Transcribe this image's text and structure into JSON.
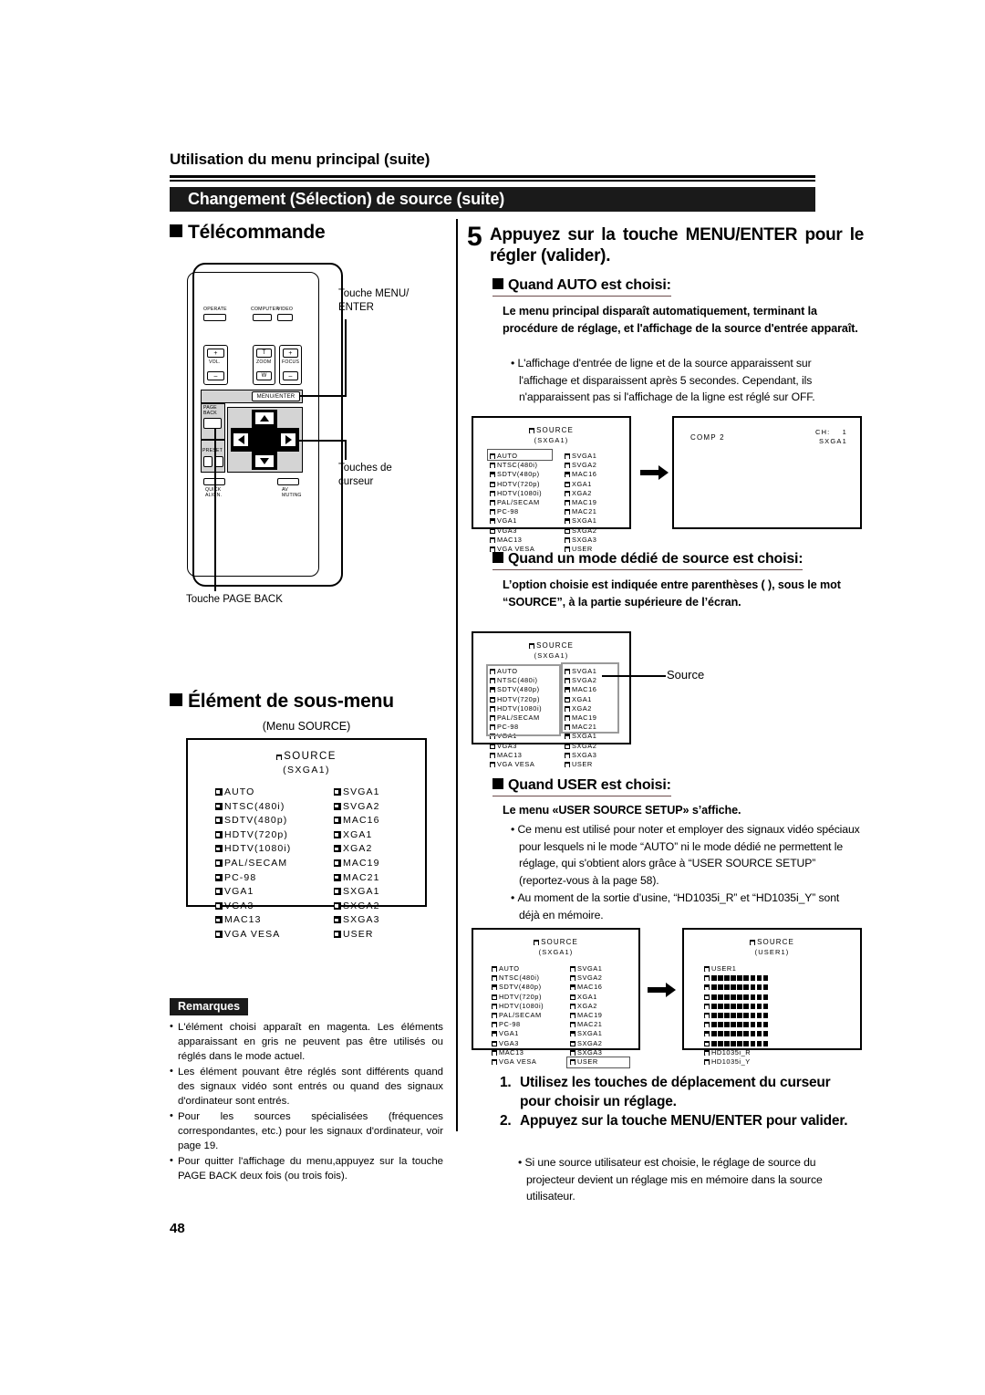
{
  "header": {
    "running_head": "Utilisation du menu principal (suite)",
    "title_band": "Changement (Sélection) de source (suite)"
  },
  "left_column": {
    "remote_heading": "Télécommande",
    "remote": {
      "buttons": [
        {
          "name": "operate",
          "label": "OPERATE"
        },
        {
          "name": "computer",
          "label": "COMPUTER"
        },
        {
          "name": "video",
          "label": "VIDEO"
        },
        {
          "name": "vol",
          "label": "VOL."
        },
        {
          "name": "vol-plus",
          "label": "+"
        },
        {
          "name": "vol-minus",
          "label": "–"
        },
        {
          "name": "zoom",
          "label": "ZOOM"
        },
        {
          "name": "zoom-t",
          "label": "T"
        },
        {
          "name": "zoom-w",
          "label": "W"
        },
        {
          "name": "focus",
          "label": "FOCUS"
        },
        {
          "name": "focus-plus",
          "label": "+"
        },
        {
          "name": "focus-minus",
          "label": "–"
        },
        {
          "name": "menu-enter",
          "label": "MENU/ENTER"
        },
        {
          "name": "page-back",
          "label": "PAGE\nBACK"
        },
        {
          "name": "preset",
          "label": "PRESET"
        },
        {
          "name": "quick-align",
          "label": "QUICK\nALIGN."
        },
        {
          "name": "av-muting",
          "label": "AV\nMUTING"
        }
      ],
      "callouts": {
        "menu_enter": "Touche MENU/\nENTER",
        "cursor": "Touches de\ncurseur",
        "page_back": "Touche PAGE BACK"
      }
    },
    "submenu_heading": "Élément de sous-menu",
    "submenu_caption": "(Menu SOURCE)",
    "remarques_label": "Remarques",
    "remarques": [
      "L'élément choisi apparaît en magenta. Les éléments apparaissant en gris ne peuvent pas être utilisés ou réglés dans le mode actuel.",
      "Les élément pouvant être réglés sont différents quand des signaux vidéo sont entrés ou quand des signaux d'ordinateur sont entrés.",
      "Pour les sources spécialisées (fréquences correspondantes, etc.) pour les signaux d'ordinateur, voir page 19.",
      "Pour quitter l'affichage du menu,appuyez sur la touche PAGE BACK deux fois (ou trois fois)."
    ]
  },
  "right_column": {
    "step_number": "5",
    "step_text": "Appuyez sur la touche MENU/ENTER pour le régler (valider).",
    "section_auto": {
      "heading": "Quand AUTO est choisi:",
      "bold_text": "Le menu principal disparaît automatiquement, terminant la procédure de réglage, et l'affichage de la source d'entrée apparaît.",
      "bullet": "L'affichage d'entrée de ligne et de la source apparaissent sur l'affichage et disparaissent après 5 secondes. Cependant, ils n'apparaissent pas si l'affichage de la ligne est réglé sur OFF."
    },
    "section_dedicated": {
      "heading": "Quand un mode dédié de source est choisi:",
      "bold_text": "L’option choisie est indiquée entre parenthèses (  ), sous le mot “SOURCE”, à la partie supérieure de l’écran.",
      "callout": "Source"
    },
    "section_user": {
      "heading": "Quand USER est choisi:",
      "bold_text": "Le menu «USER SOURCE SETUP» s’affiche.",
      "bullets": [
        "Ce menu est utilisé pour noter et employer des signaux vidéo spéciaux pour lesquels ni le mode “AUTO” ni le mode dédié ne permettent le réglage, qui s'obtient alors grâce à “USER SOURCE SETUP” (reportez-vous à la page 58).",
        "Au moment de la sortie d’usine, “HD1035i_R” et “HD1035i_Y” sont déjà en mémoire."
      ]
    },
    "numbered_steps": [
      {
        "n": "1.",
        "text": "Utilisez les touches de déplacement du curseur pour choisir un réglage."
      },
      {
        "n": "2.",
        "text": "Appuyez sur la touche MENU/ENTER pour valider."
      }
    ],
    "final_bullet": "Si une source utilisateur est choisie, le réglage de source du projecteur devient un réglage mis en mémoire dans la source utilisateur."
  },
  "osd": {
    "source_title": "SOURCE",
    "source_sub_sxga1": "(SXGA1)",
    "source_sub_user1": "(USER1)",
    "column_left": [
      "AUTO",
      "NTSC(480i)",
      "SDTV(480p)",
      "HDTV(720p)",
      "HDTV(1080i)",
      "PAL/SECAM",
      "PC-98",
      "VGA1",
      "VGA3",
      "MAC13",
      "VGA VESA"
    ],
    "column_right": [
      "SVGA1",
      "SVGA2",
      "MAC16",
      "XGA1",
      "XGA2",
      "MAC19",
      "MAC21",
      "SXGA1",
      "SXGA2",
      "SXGA3",
      "USER"
    ],
    "input_screen": {
      "line": "COMP 2",
      "ch_label": "CH:",
      "ch_value": "1",
      "source_value": "SXGA1"
    },
    "user_screen": {
      "first": "USER1",
      "masked_rows": 8,
      "blocks_per_row": 9,
      "last": [
        "HD1035i_R",
        "HD1035i_Y"
      ]
    }
  },
  "page_number": "48"
}
